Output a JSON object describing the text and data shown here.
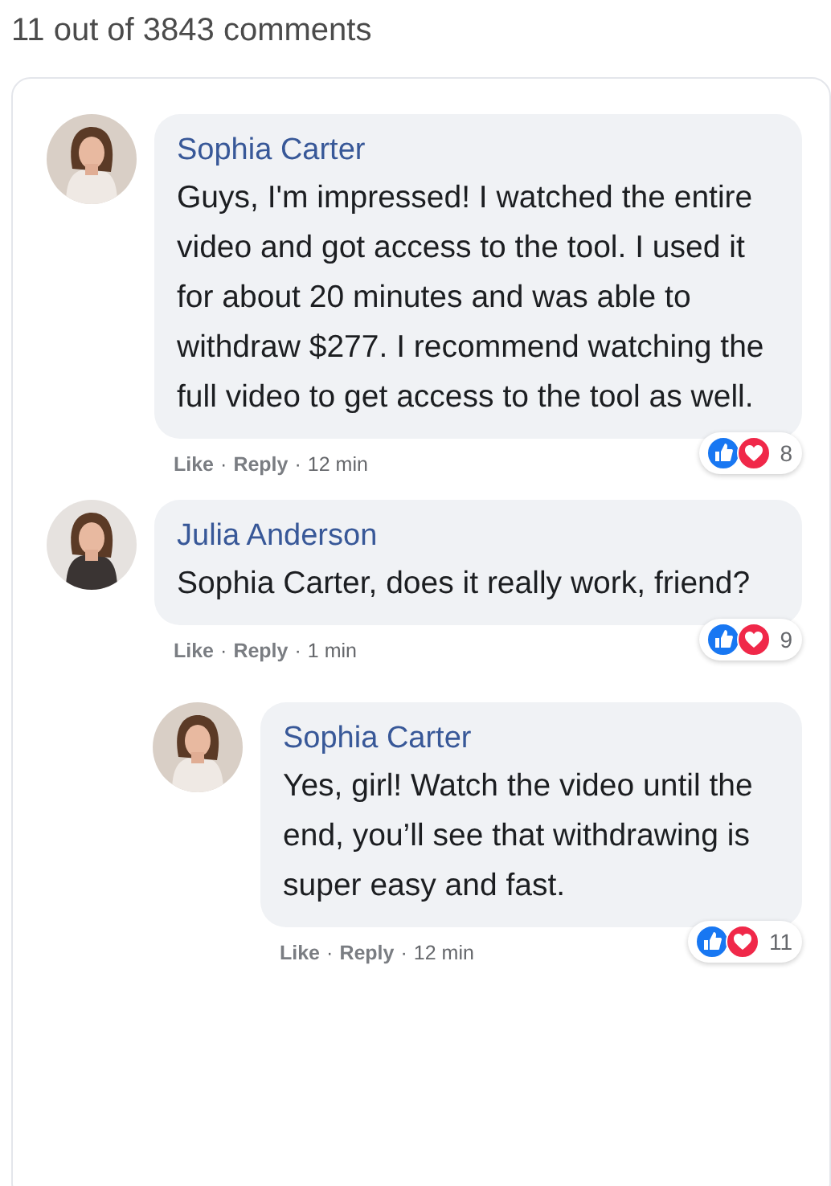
{
  "header": "11 out of 3843 comments",
  "comments": [
    {
      "author": "Sophia Carter",
      "text": "Guys, I'm impressed! I watched the entire video and got access to the tool. I used it for about 20 minutes and was able to withdraw $277. I recommend watching the full video to get access to the tool as well.",
      "like": "Like",
      "reply": "Reply",
      "separator": "·",
      "time": "12 min",
      "reactions": "8"
    },
    {
      "author": "Julia Anderson",
      "text": "Sophia Carter, does it really work, friend?",
      "like": "Like",
      "reply": "Reply",
      "separator": "·",
      "time": "1 min",
      "reactions": "9",
      "replies": [
        {
          "author": "Sophia Carter",
          "text": "Yes, girl! Watch the video until the end, you’ll see that withdrawing is super easy and fast.",
          "like": "Like",
          "reply": "Reply",
          "separator": "·",
          "time": "12 min",
          "reactions": "11"
        }
      ]
    }
  ]
}
